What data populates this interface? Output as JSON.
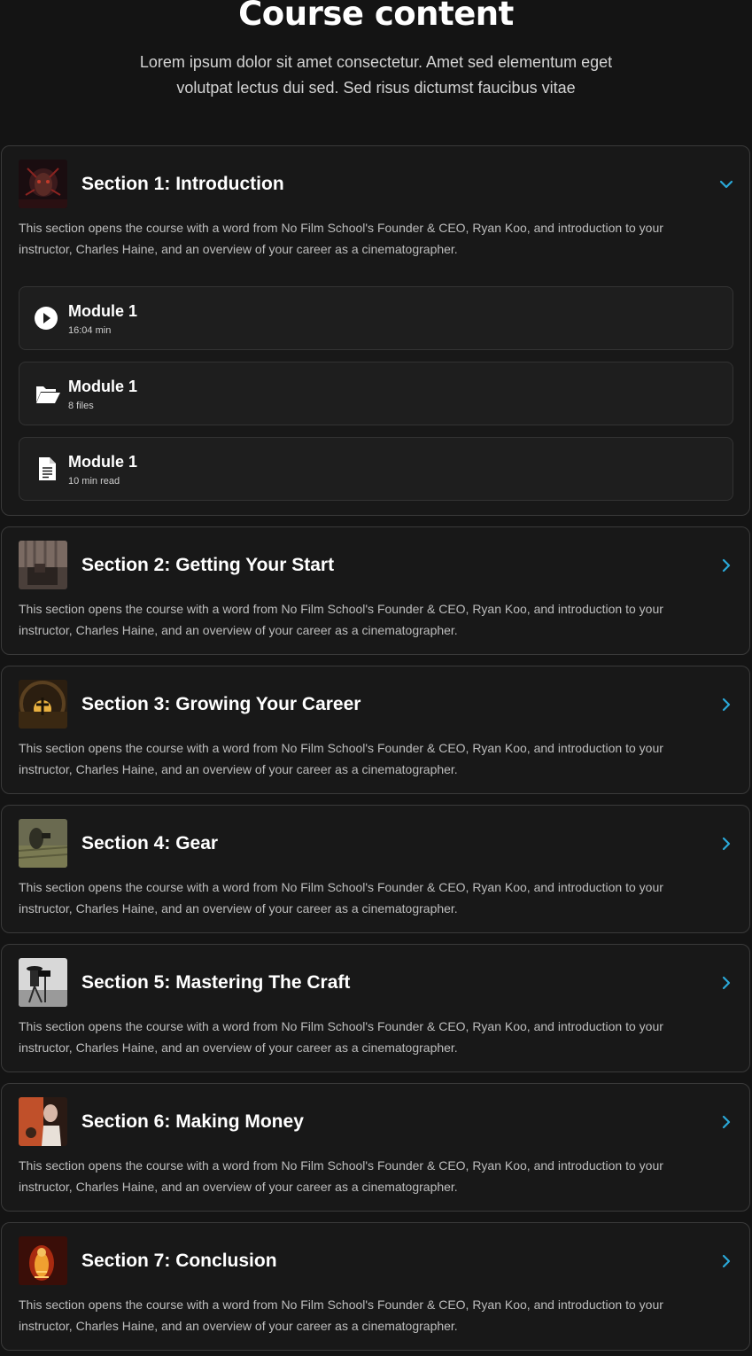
{
  "header": {
    "title": "Course content",
    "subtitle": "Lorem ipsum dolor sit amet consectetur. Amet sed elementum eget volutpat lectus dui sed. Sed risus dictumst faucibus vitae"
  },
  "colors": {
    "background": "#141414",
    "card": "#181818",
    "accent": "#2aa8d8"
  },
  "sections": [
    {
      "title": "Section 1: Introduction",
      "description": "This section opens the course with a word from No Film School's Founder & CEO, Ryan Koo, and introduction to your instructor, Charles Haine, and an overview of your career as a cinematographer.",
      "expanded": true,
      "toggle_icon": "chevron-down-icon",
      "modules": [
        {
          "title": "Module 1",
          "meta": "16:04 min",
          "icon": "play-icon"
        },
        {
          "title": "Module 1",
          "meta": "8 files",
          "icon": "folder-open-icon"
        },
        {
          "title": "Module 1",
          "meta": "10 min read",
          "icon": "document-icon"
        }
      ]
    },
    {
      "title": "Section 2: Getting Your Start",
      "description": "This section opens the course with a word from No Film School's Founder & CEO, Ryan Koo, and introduction to your instructor, Charles Haine, and an overview of your career as a cinematographer.",
      "expanded": false,
      "toggle_icon": "chevron-right-icon"
    },
    {
      "title": "Section 3: Growing Your Career",
      "description": "This section opens the course with a word from No Film School's Founder & CEO, Ryan Koo, and introduction to your instructor, Charles Haine, and an overview of your career as a cinematographer.",
      "expanded": false,
      "toggle_icon": "chevron-right-icon"
    },
    {
      "title": "Section 4: Gear",
      "description": "This section opens the course with a word from No Film School's Founder & CEO, Ryan Koo, and introduction to your instructor, Charles Haine, and an overview of your career as a cinematographer.",
      "expanded": false,
      "toggle_icon": "chevron-right-icon"
    },
    {
      "title": "Section 5: Mastering The Craft",
      "description": "This section opens the course with a word from No Film School's Founder & CEO, Ryan Koo, and introduction to your instructor, Charles Haine, and an overview of your career as a cinematographer.",
      "expanded": false,
      "toggle_icon": "chevron-right-icon"
    },
    {
      "title": "Section 6: Making Money",
      "description": "This section opens the course with a word from No Film School's Founder & CEO, Ryan Koo, and introduction to your instructor, Charles Haine, and an overview of your career as a cinematographer.",
      "expanded": false,
      "toggle_icon": "chevron-right-icon"
    },
    {
      "title": "Section 7: Conclusion",
      "description": "This section opens the course with a word from No Film School's Founder & CEO, Ryan Koo, and introduction to your instructor, Charles Haine, and an overview of your career as a cinematographer.",
      "expanded": false,
      "toggle_icon": "chevron-right-icon"
    }
  ]
}
